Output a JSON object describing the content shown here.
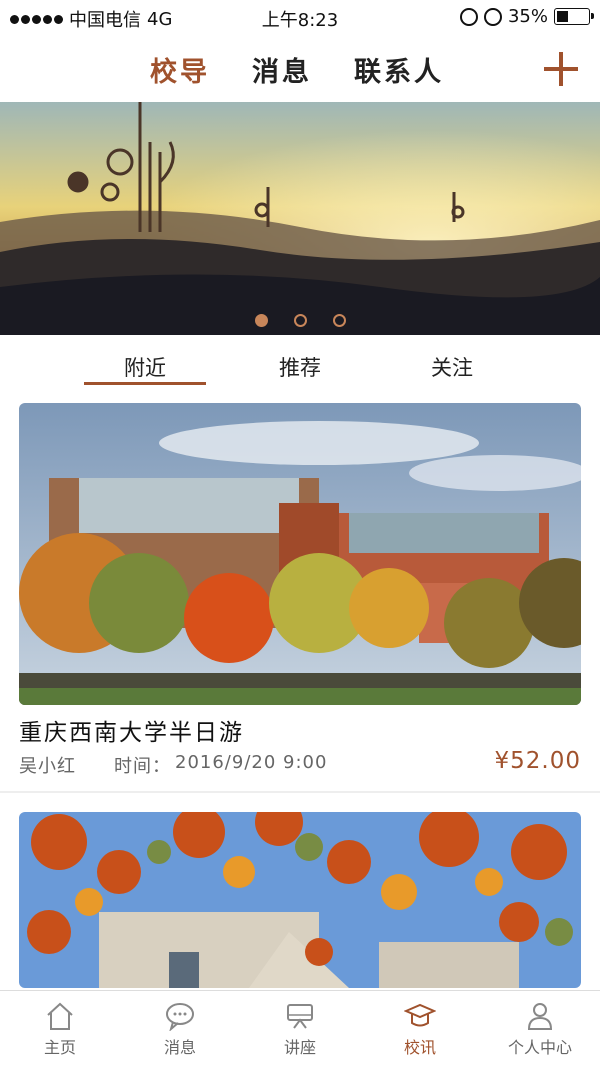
{
  "status_bar": {
    "carrier": "中国电信",
    "network": "4G",
    "time": "上午8:23",
    "battery": "35%",
    "battery_level": 0.35
  },
  "header": {
    "tabs": [
      {
        "label": "校导",
        "active": true
      },
      {
        "label": "消息",
        "active": false
      },
      {
        "label": "联系人",
        "active": false
      }
    ],
    "plus_icon": "plus-icon"
  },
  "banner": {
    "page_count": 3,
    "active_page": 1
  },
  "sub_tabs": [
    {
      "label": "附近",
      "active": true
    },
    {
      "label": "推荐",
      "active": false
    },
    {
      "label": "关注",
      "active": false
    }
  ],
  "cards": [
    {
      "title": "重庆西南大学半日游",
      "author": "吴小红",
      "time_label": "时间：",
      "time_value": "2016/9/20 9:00",
      "price": "¥52.00"
    }
  ],
  "bottom_nav": {
    "items": [
      {
        "label": "主页",
        "icon": "home-icon",
        "active": false
      },
      {
        "label": "消息",
        "icon": "chat-icon",
        "active": false
      },
      {
        "label": "讲座",
        "icon": "lecture-icon",
        "active": false
      },
      {
        "label": "校讯",
        "icon": "graduation-cap-icon",
        "active": true
      },
      {
        "label": "个人中心",
        "icon": "user-icon",
        "active": false
      }
    ]
  },
  "colors": {
    "accent": "#a0522d",
    "text": "#222222",
    "muted": "#666666"
  }
}
